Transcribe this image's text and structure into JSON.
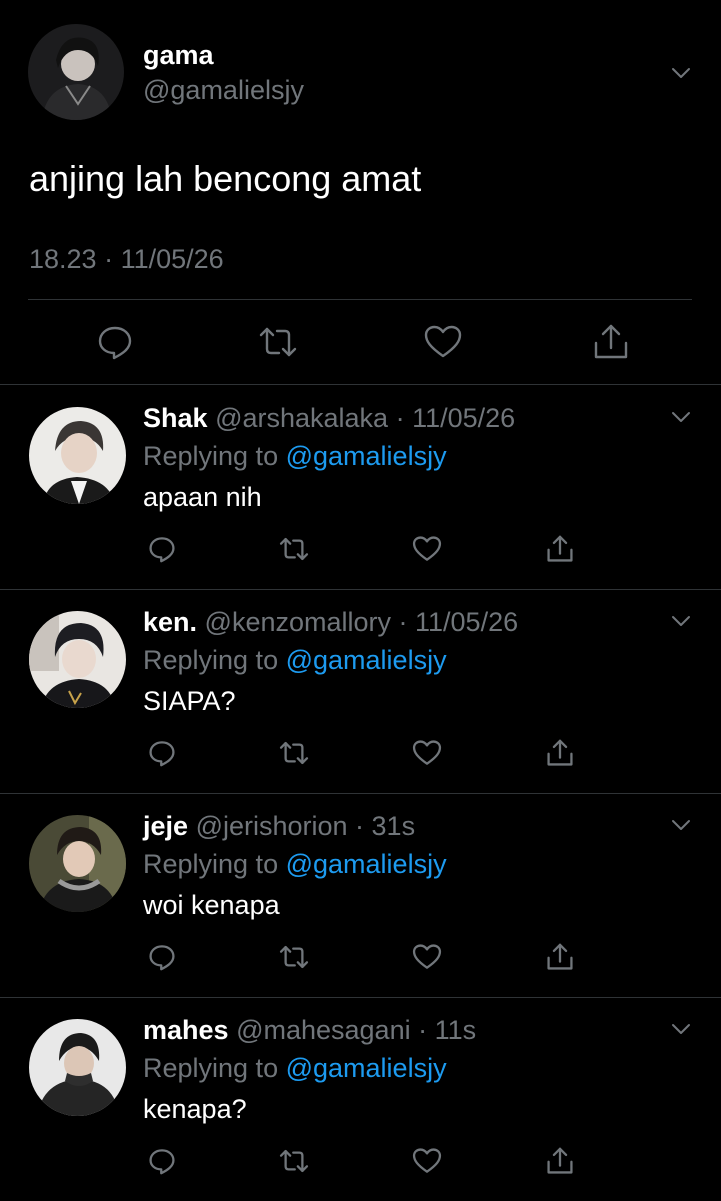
{
  "main": {
    "name": "gama",
    "handle": "@gamalielsjy",
    "text": "anjing lah bencong amat",
    "time": "18.23",
    "date": "11/05/26"
  },
  "icons": {
    "reply": "reply-icon",
    "retweet": "retweet-icon",
    "like": "heart-icon",
    "share": "share-icon",
    "menu": "chevron-down-icon"
  },
  "colors": {
    "background": "#000000",
    "text": "#e7e9ea",
    "secondary": "#71767b",
    "link": "#1d9bf0",
    "divider": "#2f3336"
  },
  "reply_prefix": "Replying to",
  "replies": [
    {
      "name": "Shak",
      "handle": "@arshakalaka",
      "when": "11/05/26",
      "replying_to": "@gamalielsjy",
      "text": "apaan nih"
    },
    {
      "name": "ken.",
      "handle": "@kenzomallory",
      "when": "11/05/26",
      "replying_to": "@gamalielsjy",
      "text": "SIAPA?"
    },
    {
      "name": "jeje",
      "handle": "@jerishorion",
      "when": "31s",
      "replying_to": "@gamalielsjy",
      "text": "woi kenapa"
    },
    {
      "name": "mahes",
      "handle": "@mahesagani",
      "when": "11s",
      "replying_to": "@gamalielsjy",
      "text": "kenapa?"
    }
  ]
}
